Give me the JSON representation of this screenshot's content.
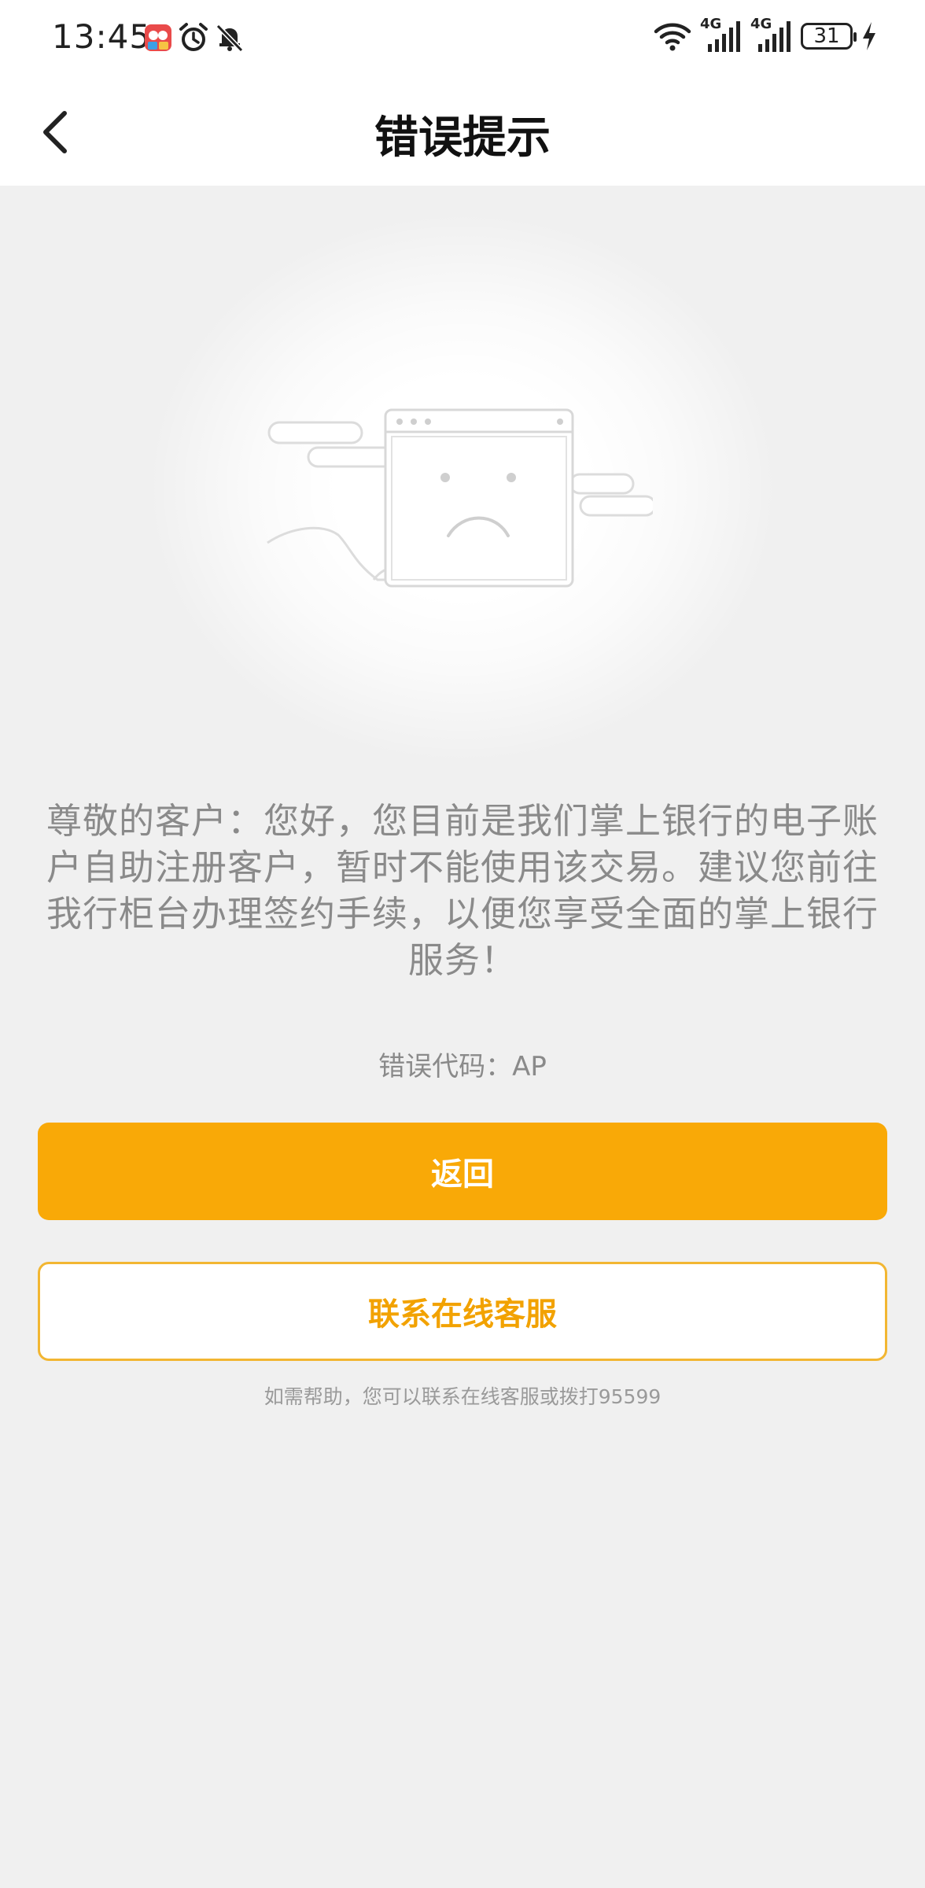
{
  "status_bar": {
    "time": "13:45",
    "signal_1_label": "4G",
    "signal_2_label": "4G",
    "battery_level": "31",
    "left_icons": [
      "app-notification-icon",
      "alarm-icon",
      "bell-muted-icon"
    ],
    "right_icons": [
      "wifi-icon",
      "signal-icon",
      "signal-icon",
      "battery-icon",
      "charging-icon"
    ]
  },
  "header": {
    "title": "错误提示",
    "back_icon": "chevron-left-icon"
  },
  "illustration": {
    "icon": "sad-browser-window-icon"
  },
  "error": {
    "message": "尊敬的客户：您好，您目前是我们掌上银行的电子账户自助注册客户，暂时不能使用该交易。建议您前往我行柜台办理签约手续，以便您享受全面的掌上银行服务！",
    "code_text": "错误代码：AP"
  },
  "actions": {
    "return_label": "返回",
    "contact_label": "联系在线客服",
    "help_text": "如需帮助，您可以联系在线客服或拨打95599"
  },
  "colors": {
    "accent": "#f9a907",
    "accent_border": "#f2b632",
    "accent_text": "#f2a200",
    "background": "#f0f0f0"
  }
}
